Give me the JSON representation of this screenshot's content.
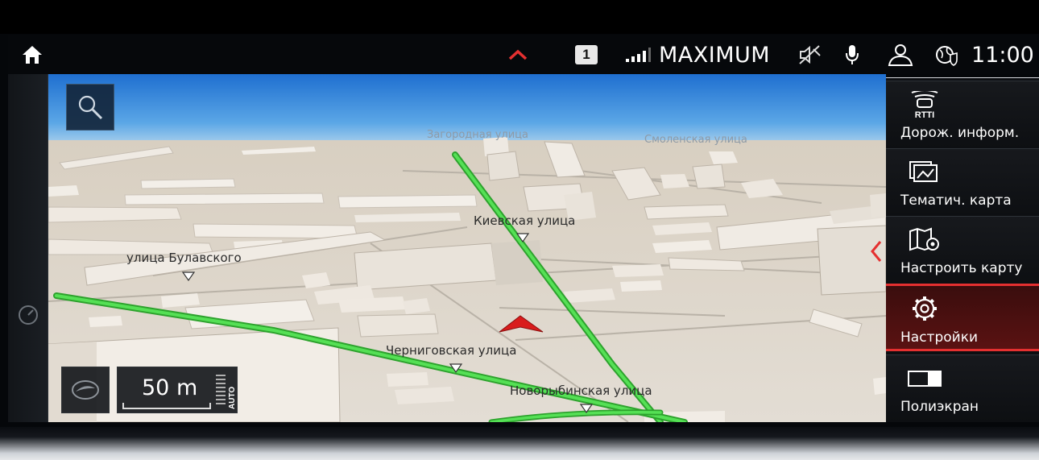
{
  "status_bar": {
    "messages_count": "1",
    "signal_bars": 4,
    "provider": "MAXIMUM",
    "clock": "11:00",
    "icons": [
      "home-icon",
      "chevron-up-icon",
      "signal-icon",
      "mute-icon",
      "microphone-icon",
      "user-icon",
      "globe-icon"
    ]
  },
  "map": {
    "streets": {
      "kievskaya": "Киевская улица",
      "bulavskogo": "улица Булавского",
      "chernigovskaya": "Черниговская улица",
      "novorybinskaya": "Новорыбинская улица",
      "smolenskaya": "Смоленская улица",
      "faded_top": "Загородная улица"
    },
    "scale": "50 m",
    "auto_label": "AUTO",
    "colors": {
      "route": "#3fd63f",
      "vehicle": "#e02020",
      "sky": "#2f7fd6",
      "ground": "#ddd6cb"
    }
  },
  "side_menu": {
    "items": [
      {
        "label": "Дорож. информ.",
        "icon_text": "RTTI",
        "icon": "traffic-info-icon"
      },
      {
        "label": "Тематич. карта",
        "icon": "thematic-map-icon"
      },
      {
        "label": "Настроить карту",
        "icon": "map-settings-icon"
      },
      {
        "label": "Настройки",
        "icon": "settings-gear-icon",
        "active": true
      },
      {
        "label": "Полиэкран",
        "icon": "split-screen-icon"
      }
    ],
    "accent_color": "#e43030"
  }
}
